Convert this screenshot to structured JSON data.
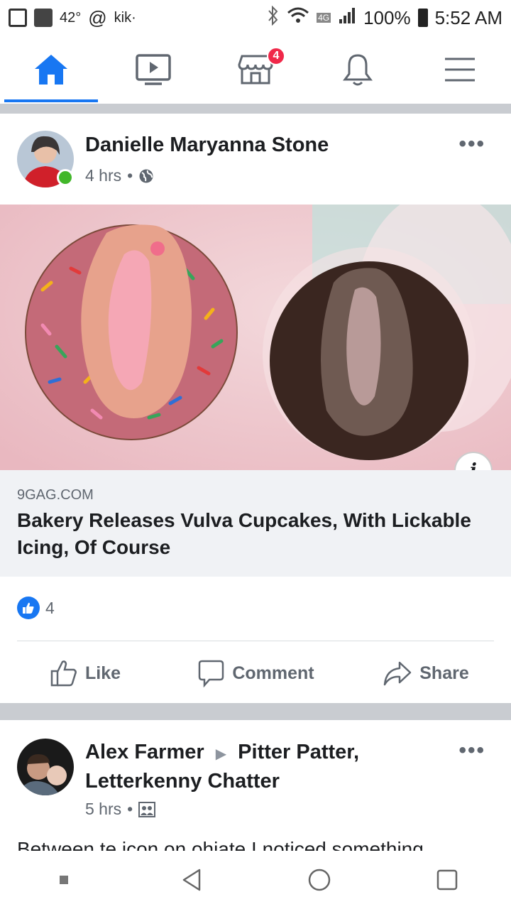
{
  "statusbar": {
    "temp": "42°",
    "kik": "kik·",
    "network": "4G",
    "battery": "100%",
    "time": "5:52 AM"
  },
  "nav": {
    "marketplace_badge": "4"
  },
  "post1": {
    "author": "Danielle Maryanna Stone",
    "time": "4 hrs",
    "link_domain": "9GAG.COM",
    "link_title": "Bakery Releases Vulva Cupcakes, With Lickable Icing, Of Course",
    "info_label": "i",
    "likes": "4",
    "actions": {
      "like": "Like",
      "comment": "Comment",
      "share": "Share"
    }
  },
  "post2": {
    "author": "Alex Farmer",
    "group": "Pitter Patter, Letterkenny Chatter",
    "time": "5 hrs",
    "text_preview": "Between te icon on ohiate I noticed something"
  },
  "colors": {
    "accent": "#1877f2",
    "badge": "#f02849",
    "online": "#42b72a"
  }
}
